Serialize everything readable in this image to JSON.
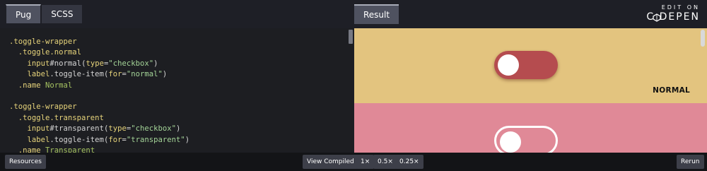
{
  "editor_tabs": [
    "Pug",
    "SCSS"
  ],
  "result_tab": "Result",
  "codepen": {
    "edit_on": "EDIT ON",
    "wordmark": "C DEPEN"
  },
  "code_lines": [
    [
      {
        "t": ".toggle-wrapper",
        "c": "cls"
      }
    ],
    [
      {
        "t": "  .toggle.normal",
        "c": "cls"
      }
    ],
    [
      {
        "t": "    input",
        "c": "cls"
      },
      {
        "t": "#normal",
        "c": "plain"
      },
      {
        "t": "(",
        "c": "plain"
      },
      {
        "t": "type",
        "c": "cls"
      },
      {
        "t": "=",
        "c": "plain"
      },
      {
        "t": "\"checkbox\"",
        "c": "str"
      },
      {
        "t": ")",
        "c": "plain"
      }
    ],
    [
      {
        "t": "    label",
        "c": "cls"
      },
      {
        "t": ".toggle-item",
        "c": "plain"
      },
      {
        "t": "(",
        "c": "plain"
      },
      {
        "t": "for",
        "c": "cls"
      },
      {
        "t": "=",
        "c": "plain"
      },
      {
        "t": "\"normal\"",
        "c": "str"
      },
      {
        "t": ")",
        "c": "plain"
      }
    ],
    [
      {
        "t": "  .name",
        "c": "cls"
      },
      {
        "t": " Normal",
        "c": "txt"
      }
    ],
    [
      {
        "t": "",
        "c": "plain"
      }
    ],
    [
      {
        "t": ".toggle-wrapper",
        "c": "cls"
      }
    ],
    [
      {
        "t": "  .toggle.transparent",
        "c": "cls"
      }
    ],
    [
      {
        "t": "    input",
        "c": "cls"
      },
      {
        "t": "#transparent",
        "c": "plain"
      },
      {
        "t": "(",
        "c": "plain"
      },
      {
        "t": "type",
        "c": "cls"
      },
      {
        "t": "=",
        "c": "plain"
      },
      {
        "t": "\"checkbox\"",
        "c": "str"
      },
      {
        "t": ")",
        "c": "plain"
      }
    ],
    [
      {
        "t": "    label",
        "c": "cls"
      },
      {
        "t": ".toggle-item",
        "c": "plain"
      },
      {
        "t": "(",
        "c": "plain"
      },
      {
        "t": "for",
        "c": "cls"
      },
      {
        "t": "=",
        "c": "plain"
      },
      {
        "t": "\"transparent\"",
        "c": "str"
      },
      {
        "t": ")",
        "c": "plain"
      }
    ],
    [
      {
        "t": "  .name",
        "c": "cls"
      },
      {
        "t": " Transparent",
        "c": "txt"
      }
    ]
  ],
  "result": {
    "normal_label": "NORMAL",
    "normal_bg": "#e3c47f",
    "normal_toggle_color": "#b54c4f",
    "transparent_bg": "#e08997"
  },
  "bottom": {
    "resources": "Resources",
    "view_compiled": "View Compiled",
    "zoom": [
      "1×",
      "0.5×",
      "0.25×"
    ],
    "rerun": "Rerun"
  }
}
